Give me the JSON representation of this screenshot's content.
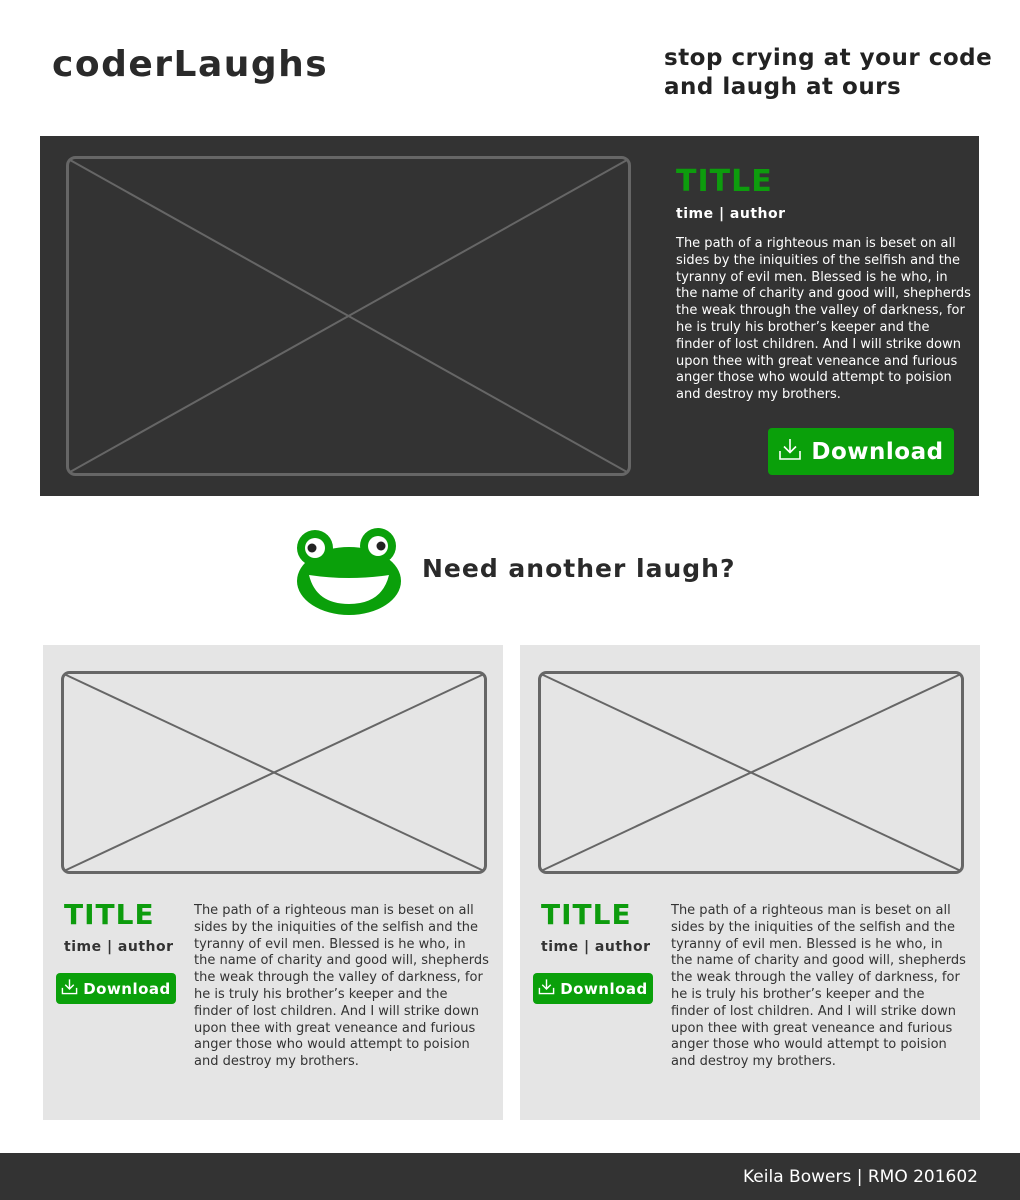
{
  "header": {
    "logo": "coderLaughs",
    "tagline_line1": "stop crying at your code",
    "tagline_line2": "and laugh at ours"
  },
  "hero": {
    "title": "TITLE",
    "meta": "time | author",
    "body": "The path of a righteous man is beset on all sides by the iniquities of the selfish and the tyranny of evil men. Blessed is he who, in the name of charity and good will, shepherds the weak through the valley of darkness, for he is truly his brother’s keeper and the finder of lost children. And I will strike down upon thee with great veneance and furious anger those who would attempt to poision and destroy my brothers.",
    "download_label": "Download"
  },
  "more": {
    "label": "Need another laugh?"
  },
  "cards": [
    {
      "title": "TITLE",
      "meta": "time | author",
      "download_label": "Download",
      "body": "The path of a righteous man is beset on all sides by the iniquities of the selfish and the tyranny of evil men. Blessed is he who, in the name of charity and good will, shepherds the weak through the valley of darkness, for he is truly his brother’s keeper and the finder of lost children. And I will strike down upon thee with great veneance and furious anger those who would attempt to poision and destroy my brothers."
    },
    {
      "title": "TITLE",
      "meta": "time | author",
      "download_label": "Download",
      "body": "The path of a righteous man is beset on all sides by the iniquities of the selfish and the tyranny of evil men. Blessed is he who, in the name of charity and good will, shepherds the weak through the valley of darkness, for he is truly his brother’s keeper and the finder of lost children. And I will strike down upon thee with great veneance and furious anger those who would attempt to poision and destroy my brothers."
    }
  ],
  "footer": {
    "text": "Keila Bowers  |  RMO 201602"
  },
  "icons": {
    "download": "download-icon",
    "frog": "frog-logo-icon",
    "placeholder": "image-placeholder-icon"
  },
  "colors": {
    "accent_green": "#0aa00a",
    "title_green": "#0d9c0d",
    "dark_panel": "#333333",
    "card_background": "#e5e5e5"
  }
}
